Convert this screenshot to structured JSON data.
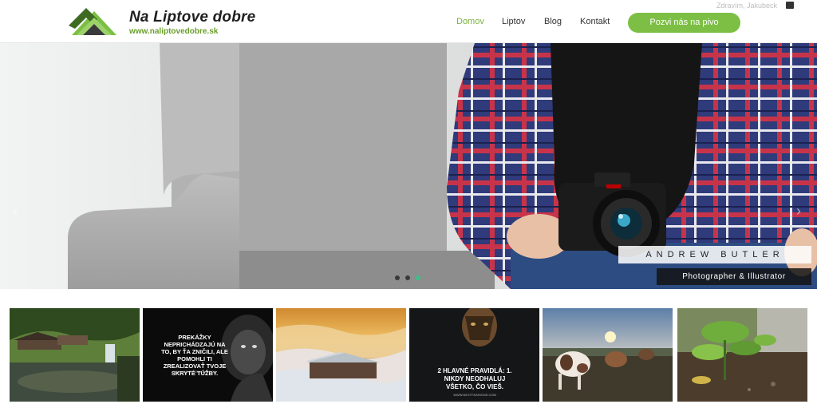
{
  "header": {
    "logo": {
      "title": "Na Liptove dobre",
      "url": "www.naliptovedobre.sk"
    },
    "nav": [
      {
        "label": "Domov",
        "active": true
      },
      {
        "label": "Liptov",
        "active": false
      },
      {
        "label": "Blog",
        "active": false
      },
      {
        "label": "Kontakt",
        "active": false
      }
    ],
    "cta_label": "Pozvi nás na pivo",
    "top_user": "Zdravím, Jakubeck"
  },
  "hero": {
    "caption_name": "ANDREW BUTLER",
    "caption_role": "Photographer & Illustrator",
    "slides": [
      {
        "active": false
      },
      {
        "active": false
      },
      {
        "active": true
      }
    ],
    "prev_icon": "chevron-left-icon",
    "next_icon": "chevron-right-icon"
  },
  "thumbnails": [
    {
      "subject": "mill-waterfall"
    },
    {
      "subject": "lion-quote",
      "text": "PREKÁŽKY NEPRICHÁDZAJÚ NA TO, BY ŤA ZNIČILI, ALE POMOHLI TI ZREALIZOVAŤ TVOJE SKRYTÉ TÚŽBY.",
      "small": "WWW.NEXTFASHIONS.COM"
    },
    {
      "subject": "cabin-clouds"
    },
    {
      "subject": "tiger-quote",
      "text": "2 HLAVNÉ PRAVIDLÁ: 1. NIKDY NEODHALUJ VŠETKO, ČO VIEŠ.",
      "small": "WWW.NEXTFASHIONS.COM"
    },
    {
      "subject": "cows-sunset"
    },
    {
      "subject": "plant-closeup"
    }
  ],
  "colors": {
    "accent": "#7cbf44",
    "active_nav": "#7cb342",
    "dot_active": "#3dbf8a"
  }
}
